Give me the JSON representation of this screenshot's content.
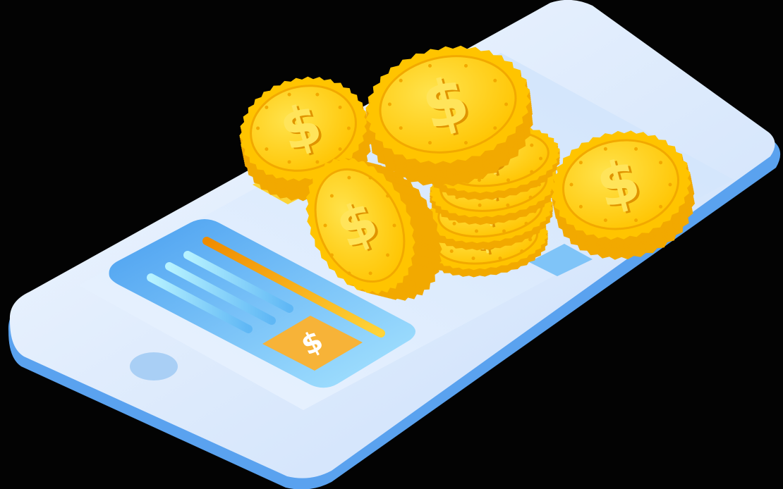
{
  "colors": {
    "background": "#030303",
    "phone_edge": "#5aa2ef",
    "phone_body": "#dcebfd",
    "phone_body_light": "#eef5ff",
    "screen": "#cfe3fb",
    "screen_light": "#e9f3ff",
    "card": "#4a9ff0",
    "card_light": "#8fd0ff",
    "card_lines": "#a9ecff",
    "card_bar": "#f4a300",
    "dollar_badge": "#f7b338",
    "coin_face": "#ffd21f",
    "coin_rim": "#ffc400",
    "coin_shadow": "#f2a900",
    "coin_dark": "#e09400",
    "home_button": "#a9cff5"
  },
  "icons": [
    "phone-illustration",
    "payment-card",
    "dollar-badge-icon",
    "coin-stack",
    "dollar-coin-icon"
  ],
  "coins": 8
}
